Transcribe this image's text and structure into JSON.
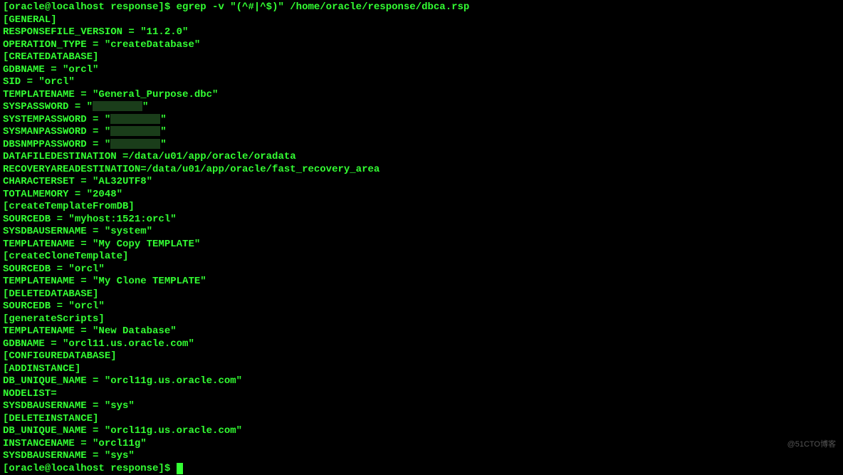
{
  "prompt": "[oracle@localhost response]$ ",
  "command": "egrep -v \"(^#|^$)\" /home/oracle/response/dbca.rsp",
  "lines": {
    "l0": "[GENERAL]",
    "l1": "RESPONSEFILE_VERSION = \"11.2.0\"",
    "l2": "OPERATION_TYPE = \"createDatabase\"",
    "l3": "[CREATEDATABASE]",
    "l4": "GDBNAME = \"orcl\"",
    "l5": "SID = \"orcl\"",
    "l6": "TEMPLATENAME = \"General_Purpose.dbc\"",
    "l7a": "SYSPASSWORD = \"",
    "l7b": "\"",
    "l8a": "SYSTEMPASSWORD = \"",
    "l8b": "\"",
    "l9a": "SYSMANPASSWORD = \"",
    "l9b": "\"",
    "l10a": "DBSNMPPASSWORD = \"",
    "l10b": "\"",
    "l11": "DATAFILEDESTINATION =/data/u01/app/oracle/oradata",
    "l12": "RECOVERYAREADESTINATION=/data/u01/app/oracle/fast_recovery_area",
    "l13": "CHARACTERSET = \"AL32UTF8\"",
    "l14": "TOTALMEMORY = \"2048\"",
    "l15": "[createTemplateFromDB]",
    "l16": "SOURCEDB = \"myhost:1521:orcl\"",
    "l17": "SYSDBAUSERNAME = \"system\"",
    "l18": "TEMPLATENAME = \"My Copy TEMPLATE\"",
    "l19": "[createCloneTemplate]",
    "l20": "SOURCEDB = \"orcl\"",
    "l21": "TEMPLATENAME = \"My Clone TEMPLATE\"",
    "l22": "[DELETEDATABASE]",
    "l23": "SOURCEDB = \"orcl\"",
    "l24": "[generateScripts]",
    "l25": "TEMPLATENAME = \"New Database\"",
    "l26": "GDBNAME = \"orcl11.us.oracle.com\"",
    "l27": "[CONFIGUREDATABASE]",
    "l28": "[ADDINSTANCE]",
    "l29": "DB_UNIQUE_NAME = \"orcl11g.us.oracle.com\"",
    "l30": "NODELIST=",
    "l31": "SYSDBAUSERNAME = \"sys\"",
    "l32": "[DELETEINSTANCE]",
    "l33": "DB_UNIQUE_NAME = \"orcl11g.us.oracle.com\"",
    "l34": "INSTANCENAME = \"orcl11g\"",
    "l35": "SYSDBAUSERNAME = \"sys\""
  },
  "watermark": "@51CTO博客"
}
